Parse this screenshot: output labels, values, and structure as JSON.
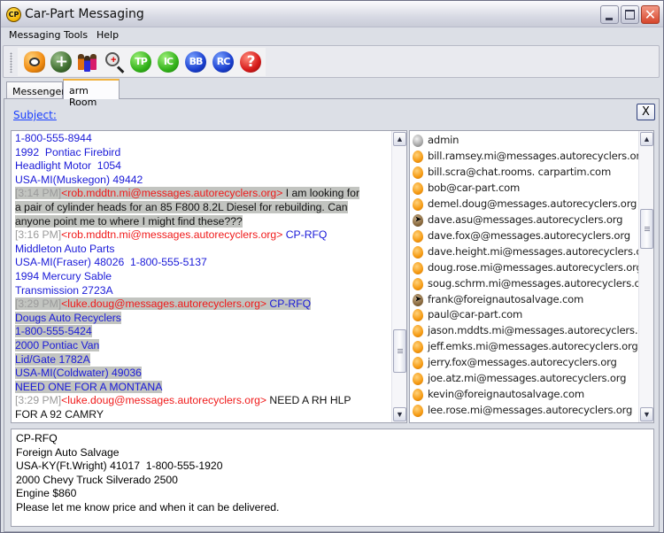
{
  "window": {
    "title": "Car-Part Messaging",
    "logo_text": "CP",
    "controls": {
      "minimize": "minimize",
      "maximize": "maximize",
      "close": "✕"
    }
  },
  "menu": [
    {
      "label": "Messaging"
    },
    {
      "label": "Tools"
    },
    {
      "label": "Help"
    }
  ],
  "toolbar": {
    "buttons": [
      {
        "name": "webcam",
        "label": ""
      },
      {
        "name": "add",
        "label": "+"
      },
      {
        "name": "people",
        "label": ""
      },
      {
        "name": "search",
        "label": "+"
      },
      {
        "name": "tp",
        "label": "TP"
      },
      {
        "name": "ic",
        "label": "IC"
      },
      {
        "name": "bb",
        "label": "BB"
      },
      {
        "name": "rc",
        "label": "RC"
      },
      {
        "name": "help",
        "label": "?"
      }
    ]
  },
  "tabs": [
    {
      "label": "Messenger",
      "active": false
    },
    {
      "label": "arm Room",
      "active": true
    }
  ],
  "room": {
    "subject_label": "Subject:",
    "close_label": "X",
    "chat": [
      {
        "type": "line",
        "style": "blue",
        "text": "1-800-555-8944"
      },
      {
        "type": "line",
        "style": "blue",
        "text": "1992  Pontiac Firebird"
      },
      {
        "type": "line",
        "style": "blue",
        "text": "Headlight Motor  1054"
      },
      {
        "type": "line",
        "style": "blue",
        "text": "USA-MI(Muskegon) 49442"
      },
      {
        "type": "msg",
        "highlight": true,
        "time": "[3:14 PM]",
        "sender": "<rob.mddtn.mi@messages.autorecyclers.org>",
        "text": " I am looking for",
        "text_style": "black"
      },
      {
        "type": "line",
        "style": "black",
        "highlight": true,
        "text": "a pair of cylinder heads for an 85 F800 8.2L Diesel for rebuilding. Can"
      },
      {
        "type": "line",
        "style": "black",
        "highlight": true,
        "text": "anyone point me to where I might find these???"
      },
      {
        "type": "msg",
        "highlight": false,
        "time": "[3:16 PM]",
        "sender": "<rob.mddtn.mi@messages.autorecyclers.org>",
        "text": " CP-RFQ",
        "text_style": "blue"
      },
      {
        "type": "line",
        "style": "blue",
        "text": "Middleton Auto Parts"
      },
      {
        "type": "line",
        "style": "blue",
        "text": "USA-MI(Fraser) 48026  1-800-555-5137"
      },
      {
        "type": "line",
        "style": "blue",
        "text": "1994 Mercury Sable"
      },
      {
        "type": "line",
        "style": "blue",
        "text": "Transmission 2723A"
      },
      {
        "type": "msg",
        "highlight": true,
        "time": "[3:29 PM]",
        "sender": "<luke.doug@messages.autorecyclers.org>",
        "text": " CP-RFQ",
        "text_style": "blue"
      },
      {
        "type": "line",
        "style": "blue",
        "highlight": true,
        "text": "Dougs Auto Recyclers"
      },
      {
        "type": "line",
        "style": "blue",
        "highlight": true,
        "text": "1-800-555-5424"
      },
      {
        "type": "line",
        "style": "blue",
        "highlight": true,
        "text": "2000 Pontiac Van"
      },
      {
        "type": "line",
        "style": "blue",
        "highlight": true,
        "text": "Lid/Gate 1782A"
      },
      {
        "type": "line",
        "style": "blue",
        "highlight": true,
        "text": "USA-MI(Coldwater) 49036"
      },
      {
        "type": "line",
        "style": "blue",
        "highlight": true,
        "text": "NEED ONE FOR A MONTANA"
      },
      {
        "type": "msg",
        "highlight": false,
        "time": "[3:29 PM]",
        "sender": "<luke.doug@messages.autorecyclers.org>",
        "text": " NEED A RH HLP",
        "text_style": "black"
      },
      {
        "type": "line",
        "style": "black",
        "text": "FOR A 92 CAMRY"
      }
    ],
    "users": [
      {
        "name": "admin",
        "status": "admin"
      },
      {
        "name": "bill.ramsey.mi@messages.autorecyclers.org",
        "status": "online"
      },
      {
        "name": "bill.scra@chat.rooms. carpartim.com",
        "status": "online"
      },
      {
        "name": "bob@car-part.com",
        "status": "online"
      },
      {
        "name": "demel.doug@messages.autorecyclers.org",
        "status": "online"
      },
      {
        "name": "dave.asu@messages.autorecyclers.org",
        "status": "away"
      },
      {
        "name": "dave.fox@@messages.autorecyclers.org",
        "status": "online"
      },
      {
        "name": "dave.height.mi@messages.autorecyclers.org",
        "status": "online"
      },
      {
        "name": "doug.rose.mi@messages.autorecyclers.org",
        "status": "online"
      },
      {
        "name": "soug.schrm.mi@messages.autorecyclers.org",
        "status": "online"
      },
      {
        "name": "frank@foreignautosalvage.com",
        "status": "away"
      },
      {
        "name": "paul@car-part.com",
        "status": "online"
      },
      {
        "name": "jason.mddts.mi@messages.autorecyclers.org",
        "status": "online"
      },
      {
        "name": "jeff.emks.mi@messages.autorecyclers.org",
        "status": "online"
      },
      {
        "name": "jerry.fox@messages.autorecyclers.org",
        "status": "online"
      },
      {
        "name": "joe.atz.mi@messages.autorecyclers.org",
        "status": "online"
      },
      {
        "name": "kevin@foreignautosalvage.com",
        "status": "online"
      },
      {
        "name": "lee.rose.mi@messages.autorecyclers.org",
        "status": "online"
      }
    ],
    "compose_text": "CP-RFQ\nForeign Auto Salvage\nUSA-KY(Ft.Wright) 41017  1-800-555-1920\n2000 Chevy Truck Silverado 2500\nEngine $860\nPlease let me know price and when it can be delivered."
  },
  "scrollbars": {
    "up": "▲",
    "down": "▼"
  }
}
